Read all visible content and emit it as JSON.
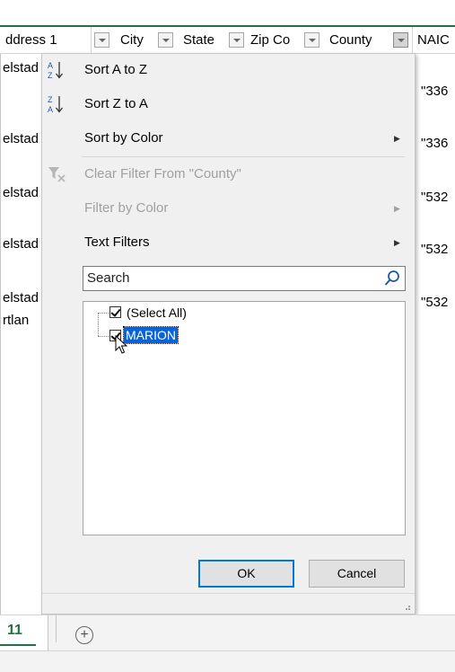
{
  "columns": [
    {
      "name": "address",
      "label": "ddress 1"
    },
    {
      "name": "city",
      "label": "City"
    },
    {
      "name": "state",
      "label": "State"
    },
    {
      "name": "zip",
      "label": "Zip Co"
    },
    {
      "name": "county",
      "label": "County"
    },
    {
      "name": "naic",
      "label": "NAIC"
    }
  ],
  "rows": [
    {
      "address": "elstad",
      "naic": "\"336"
    },
    {
      "address": "elstad",
      "naic": "\"336"
    },
    {
      "address": "elstad",
      "naic": "\"532"
    },
    {
      "address": "elstad",
      "naic": "\"532"
    },
    {
      "address": "elstad",
      "naic": "\"532"
    },
    {
      "address": "rtlan",
      "naic": ""
    }
  ],
  "menu": {
    "sort_az": "Sort A to Z",
    "sort_za": "Sort Z to A",
    "sort_by_color": "Sort by Color",
    "clear_filter": "Clear Filter From \"County\"",
    "filter_by_color": "Filter by Color",
    "text_filters": "Text Filters"
  },
  "search": {
    "placeholder": "Search"
  },
  "filter_list": [
    {
      "label": "(Select All)",
      "checked": true
    },
    {
      "label": "MARION",
      "checked": true,
      "selected": true
    }
  ],
  "buttons": {
    "ok": "OK",
    "cancel": "Cancel"
  },
  "sheet": {
    "active_tab": "11",
    "add_sheet_symbol": "+"
  },
  "colors": {
    "excel_green": "#217346",
    "selection_blue": "#0a64d6",
    "default_button_border": "#0078d7"
  }
}
